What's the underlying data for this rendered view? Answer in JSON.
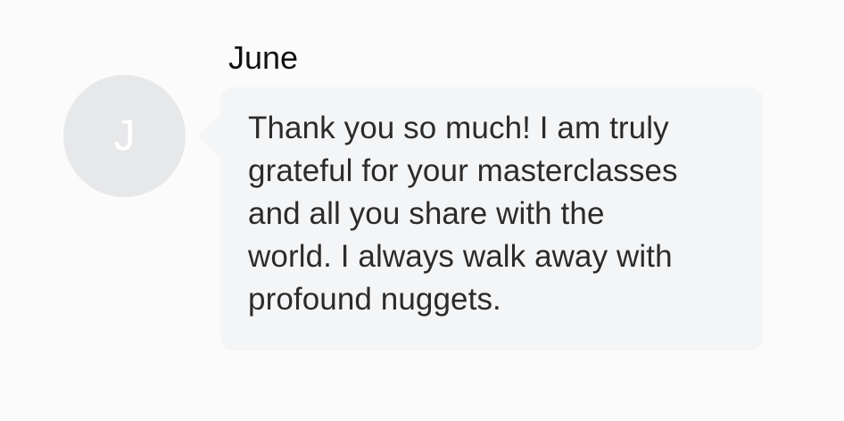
{
  "sender": {
    "name": "June",
    "initial": "J"
  },
  "message": {
    "lines": [
      "Thank you so much! I am truly",
      "grateful for your masterclasses",
      "and all you share with the",
      "world. I always walk away with",
      "profound nuggets."
    ]
  },
  "colors": {
    "background": "#fbfbfb",
    "bubble": "#f4f5f7",
    "avatar": "#e7e8ea",
    "text": "#2b2b2b"
  }
}
